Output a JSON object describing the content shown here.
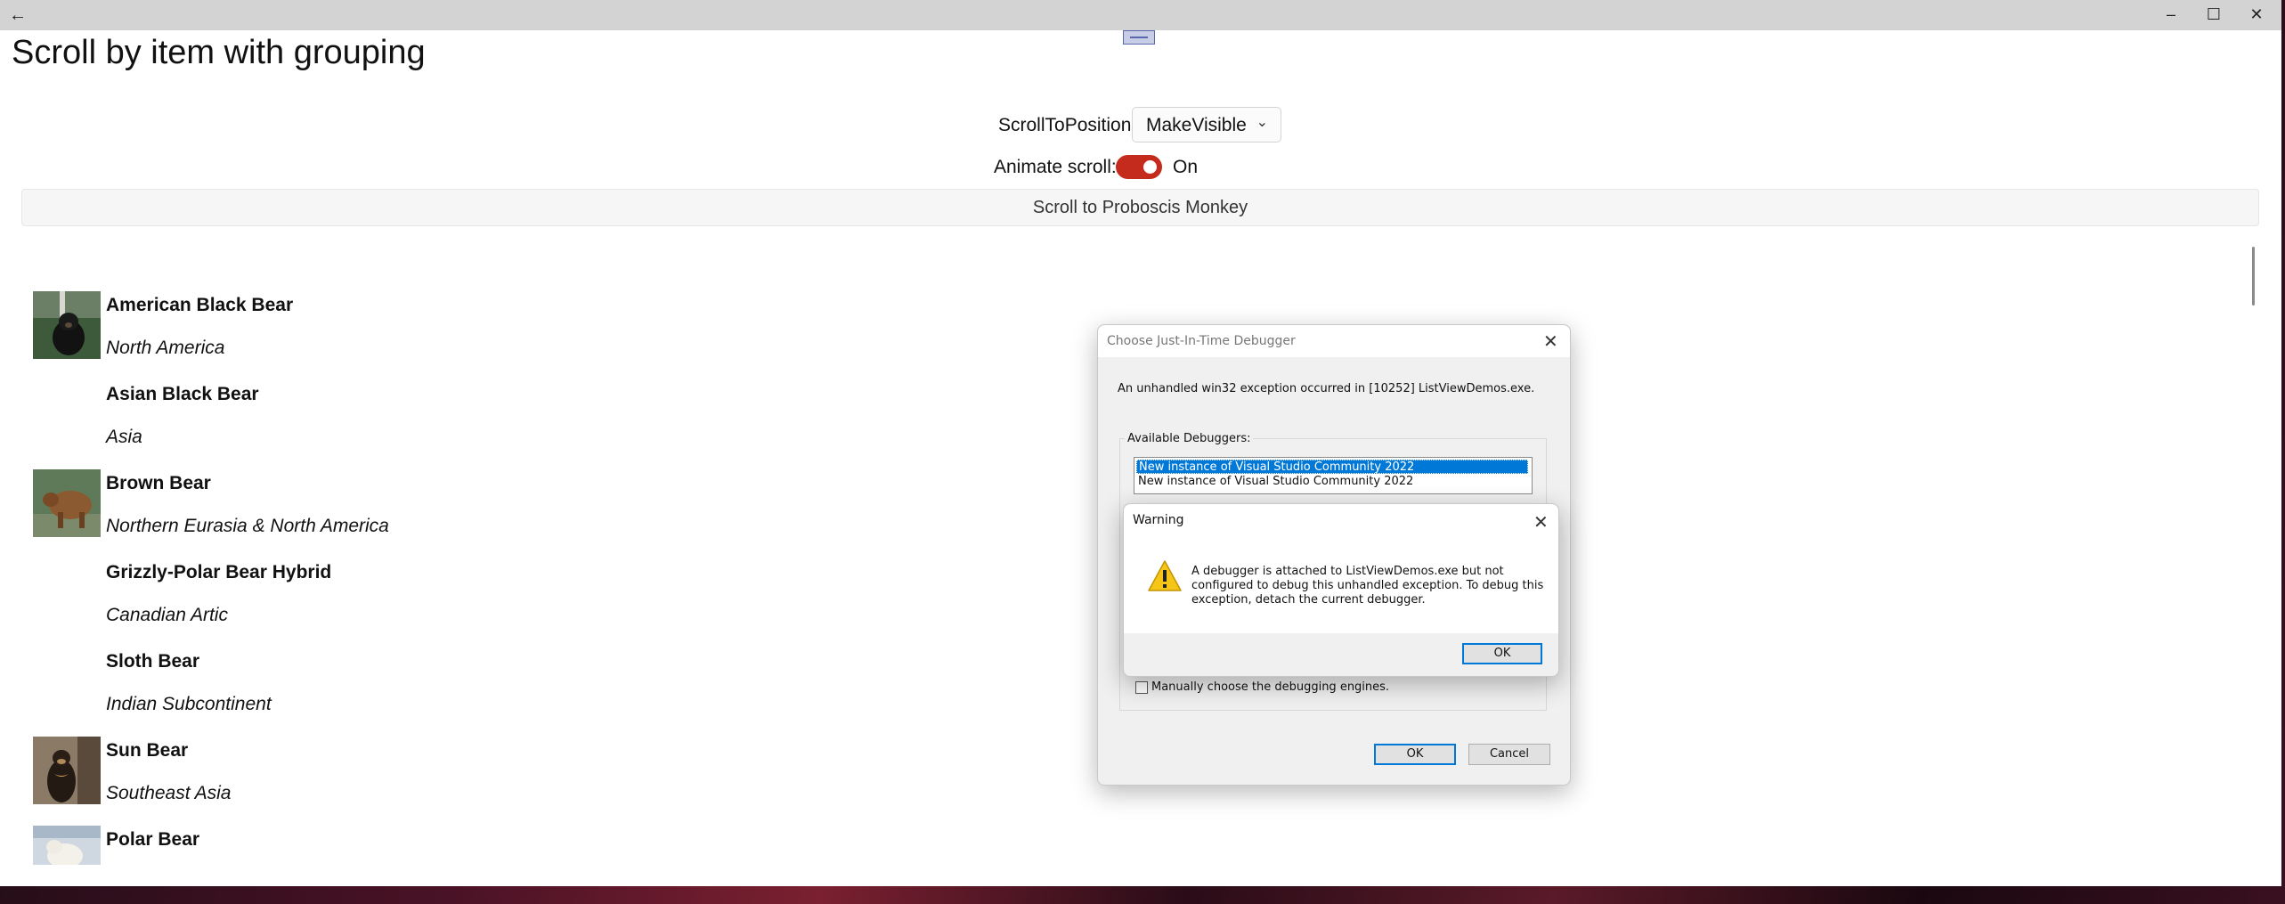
{
  "window": {
    "back_icon": "arrow-left-icon",
    "minimize_icon": "minimize-icon",
    "maximize_icon": "maximize-icon",
    "close_icon": "close-icon"
  },
  "page": {
    "title": "Scroll by item with grouping",
    "scroll_to_position_label": "ScrollToPosition:",
    "scroll_to_position_value": "MakeVisible",
    "animate_scroll_label": "Animate scroll:",
    "animate_scroll_state": "On",
    "toggle_color": "#c42b1c",
    "scroll_button_label": "Scroll to Proboscis Monkey"
  },
  "items": [
    {
      "name": "American Black Bear",
      "region": "North America",
      "has_image": true
    },
    {
      "name": "Asian Black Bear",
      "region": "Asia",
      "has_image": false
    },
    {
      "name": "Brown Bear",
      "region": "Northern Eurasia & North America",
      "has_image": true
    },
    {
      "name": "Grizzly-Polar Bear Hybrid",
      "region": "Canadian Artic",
      "has_image": false
    },
    {
      "name": "Sloth Bear",
      "region": "Indian Subcontinent",
      "has_image": false
    },
    {
      "name": "Sun Bear",
      "region": "Southeast Asia",
      "has_image": true
    },
    {
      "name": "Polar Bear",
      "region": "",
      "has_image": true
    }
  ],
  "jit_dialog": {
    "title": "Choose Just-In-Time Debugger",
    "message": "An unhandled win32 exception occurred in [10252] ListViewDemos.exe.",
    "group_label": "Available Debuggers:",
    "debuggers": [
      "New instance of Visual Studio Community 2022",
      "New instance of Visual Studio Community 2022"
    ],
    "manual_choose_label": "Manually choose the debugging engines.",
    "ok_label": "OK",
    "cancel_label": "Cancel"
  },
  "warning_dialog": {
    "title": "Warning",
    "message": "A debugger is attached to ListViewDemos.exe but not configured to debug this unhandled exception. To debug this exception, detach the current debugger.",
    "ok_label": "OK",
    "icon": "warning-icon"
  }
}
